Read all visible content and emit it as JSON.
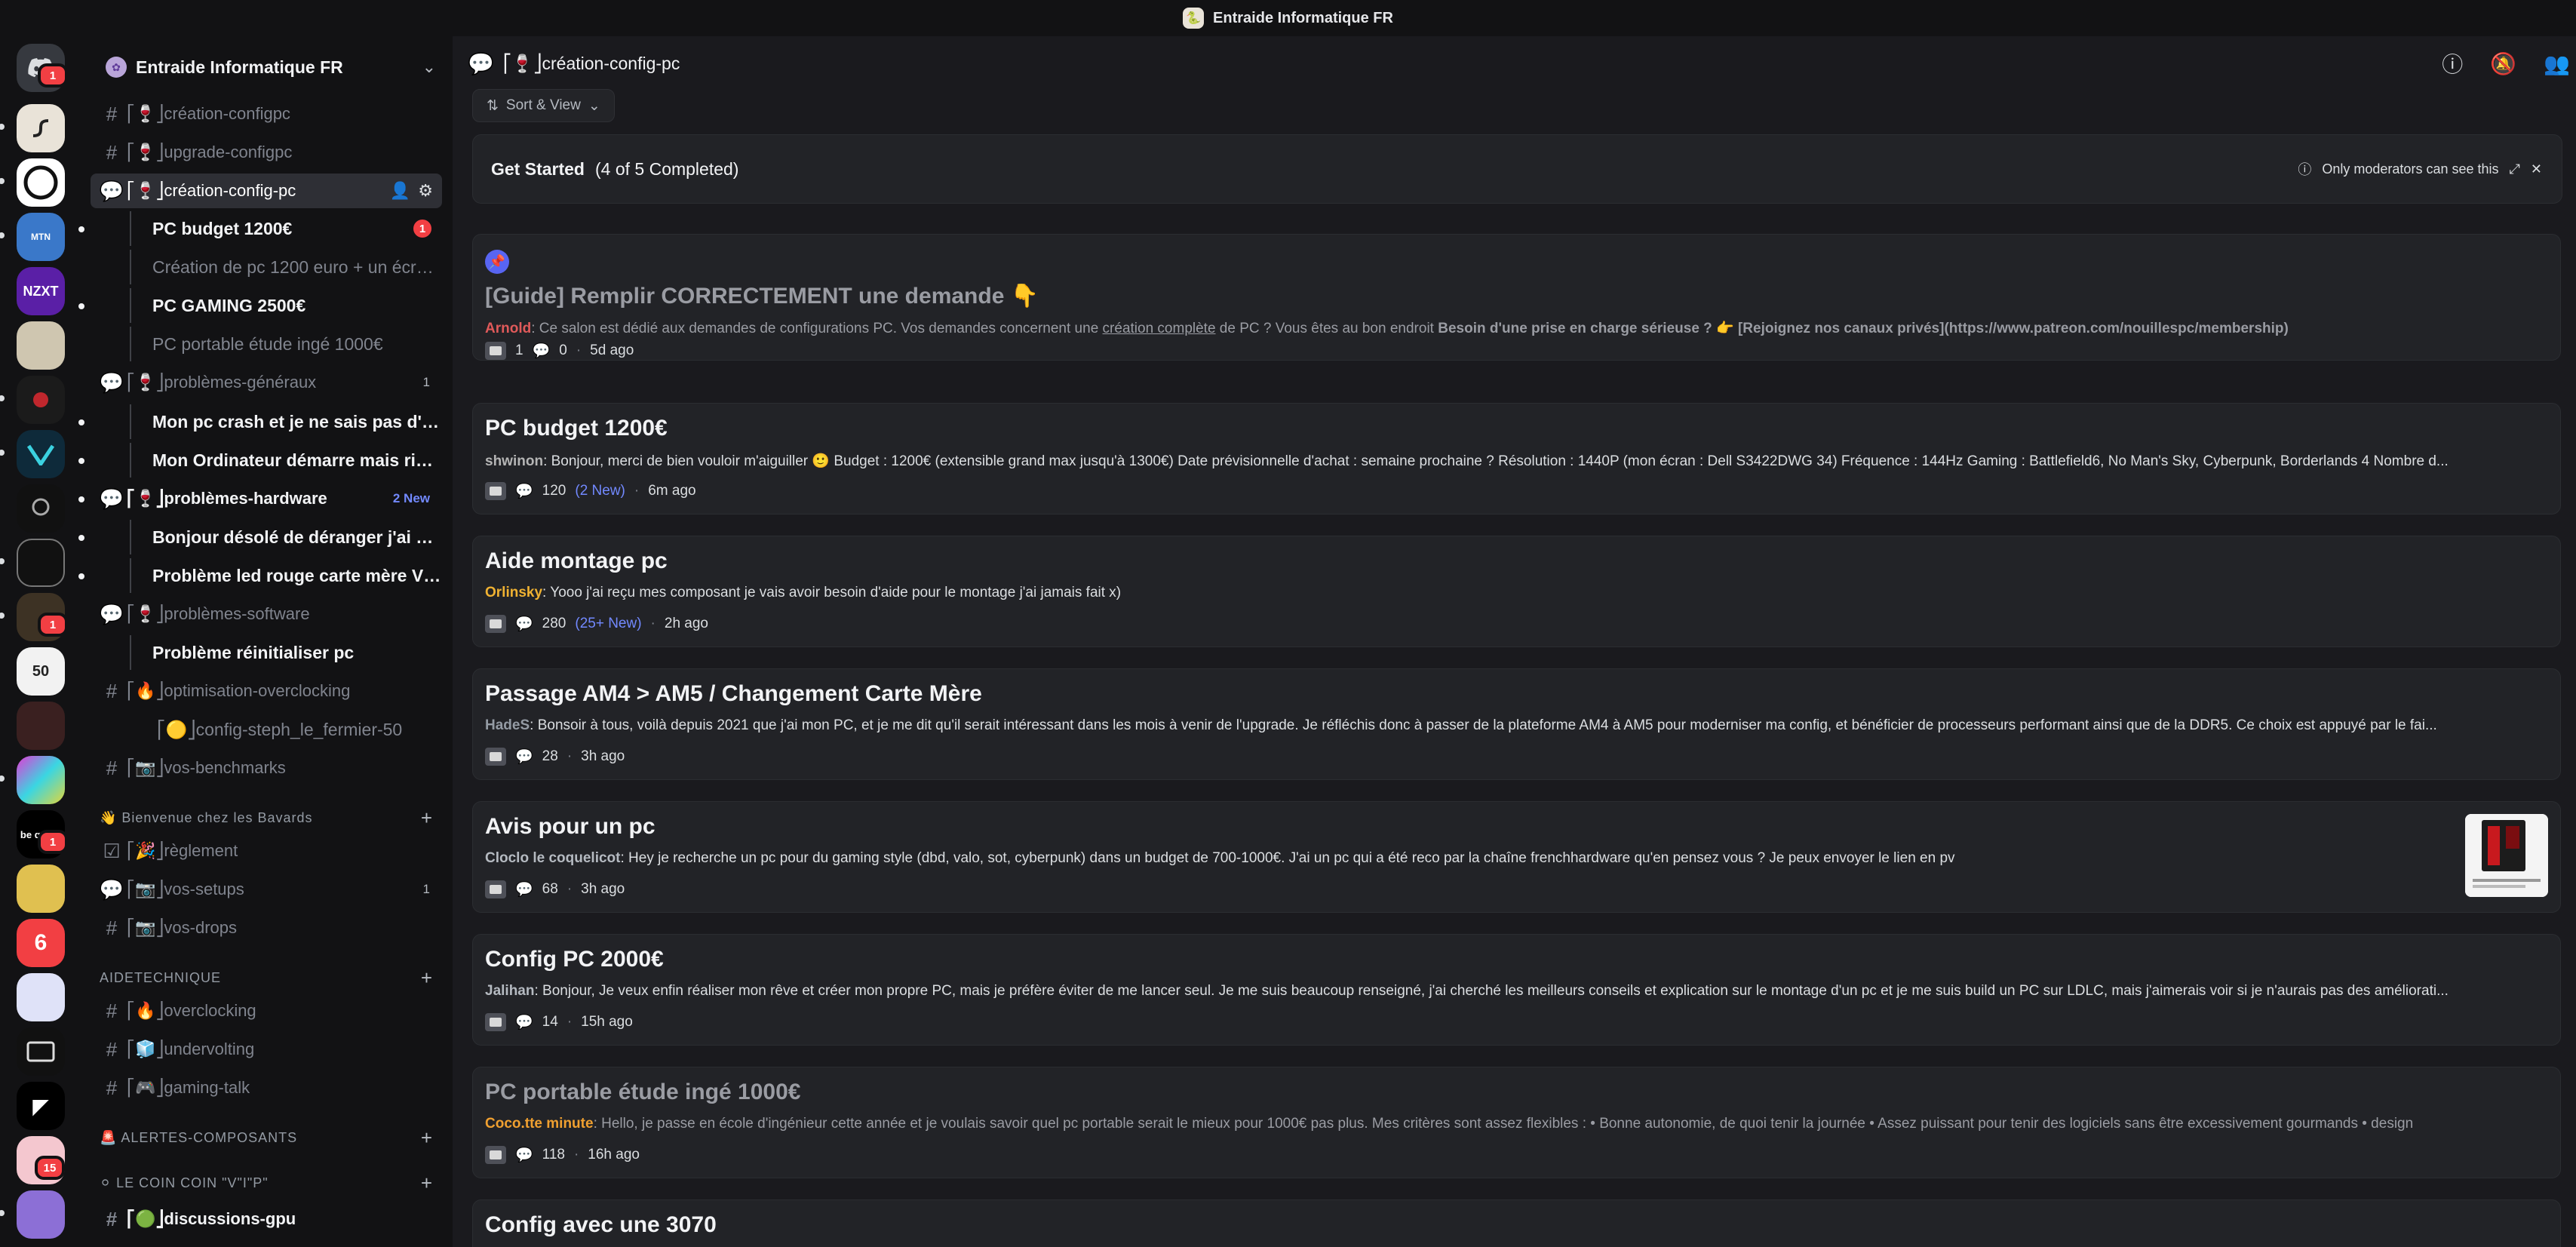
{
  "window": {
    "title": "Entraide Informatique FR"
  },
  "server_rail": {
    "badges": [
      "1",
      "1",
      "1",
      "1",
      "15"
    ]
  },
  "sidebar": {
    "server_name": "Entraide Informatique FR",
    "channels": {
      "creation_configpc": "⎡🍷⎦création-configpc",
      "upgrade_configpc": "⎡🍷⎦upgrade-configpc",
      "creation_config_pc": "⎡🍷⎦création-config-pc",
      "problemes_generaux": "⎡🍷⎦problèmes-généraux",
      "problemes_generaux_count": "1",
      "problemes_hardware": "⎡🍷⎦problèmes-hardware",
      "problemes_hardware_new": "2 New",
      "problemes_software": "⎡🍷⎦problèmes-software",
      "optimisation_overclocking": "⎡🔥⎦optimisation-overclocking",
      "config_steph": "⎡🟡⎦config-steph_le_fermier-50",
      "vos_benchmarks": "⎡📷⎦vos-benchmarks",
      "reglement": "⎡🎉⎦règlement",
      "vos_setups": "⎡📷⎦vos-setups",
      "vos_setups_count": "1",
      "vos_drops": "⎡📷⎦vos-drops",
      "overclocking": "⎡🔥⎦overclocking",
      "undervolting": "⎡🧊⎦undervolting",
      "gaming_talk": "⎡🎮⎦gaming-talk",
      "discussions_gpu": "⎡🟢⎦discussions-gpu"
    },
    "threads": {
      "pc_budget": "PC budget 1200€",
      "pc_budget_badge": "1",
      "creation_pc": "Création de pc 1200 euro + un écran ...",
      "pc_gaming": "PC GAMING 2500€",
      "pc_portable": "PC portable étude ingé 1000€",
      "mon_pc_crash": "Mon pc crash et je ne sais pas d'où ça...",
      "mon_ordinateur": "Mon Ordinateur démarre mais rien d...",
      "bonjour_desole": "Bonjour désolé de déranger j'ai achet...",
      "probleme_led": "Problème led rouge carte mère VGA ...",
      "probleme_reinit": "Problème réinitialiser pc"
    },
    "categories": {
      "bienvenue": "👋 Bienvenue chez les Bavards",
      "aidetechnique": "AIDETECHNIQUE",
      "alertes": "🚨 ALERTES-COMPOSANTS",
      "coin": "⚪ LE COIN COIN \"V\"I\"P\""
    }
  },
  "main": {
    "channel_title": "⎡🍷⎦création-config-pc",
    "sort_label": "Sort & View",
    "get_started": {
      "title": "Get Started",
      "progress": "(4 of 5 Completed)",
      "mod_note": "Only moderators can see this"
    },
    "posts": [
      {
        "title": "[Guide] Remplir CORRECTEMENT une demande 👇",
        "author": "Arnold",
        "snippet_a": ": Ce salon est dédié aux demandes de configurations PC. Vos demandes concernent une ",
        "snippet_link": "création complète",
        "snippet_b": " de PC ? Vous êtes au bon endroit ",
        "snippet_bold": "Besoin d'une prise en charge sérieuse ? 👉 [Rejoignez nos canaux privés](https://www.patreon.com/nouillespc/membership)",
        "tag_count": "1",
        "replies": "0",
        "time": "5d ago"
      },
      {
        "title": "PC budget 1200€",
        "author": "shwinon",
        "snippet": ": Bonjour, merci de bien vouloir m'aiguiller 🙂 Budget : 1200€ (extensible grand max jusqu'à 1300€) Date prévisionnelle d'achat : semaine prochaine ? Résolution : 1440P (mon écran : Dell S3422DWG 34) Fréquence : 144Hz Gaming : Battlefield6, No Man's Sky, Cyberpunk, Borderlands 4 Nombre d...",
        "replies": "120",
        "new": "(2 New)",
        "time": "6m ago"
      },
      {
        "title": "Aide montage pc",
        "author": "Orlinsky",
        "snippet": ": Yooo j'ai reçu mes composant je vais avoir besoin d'aide pour le montage j'ai jamais fait x)",
        "replies": "280",
        "new": "(25+ New)",
        "time": "2h ago"
      },
      {
        "title": "Passage AM4 > AM5 / Changement Carte Mère",
        "author": "HadeS",
        "snippet": ": Bonsoir à tous, voilà depuis 2021 que j'ai mon PC, et je me dit qu'il serait intéressant dans les mois à venir de l'upgrade. Je réfléchis donc à passer de la plateforme AM4 à AM5 pour moderniser ma config, et bénéficier de processeurs performant ainsi que de la DDR5. Ce choix est appuyé par le fai...",
        "replies": "28",
        "time": "3h ago"
      },
      {
        "title": "Avis pour un pc",
        "author": "Cloclo le coquelicot",
        "snippet": ": Hey je recherche un pc pour du gaming style (dbd, valo, sot, cyberpunk) dans un budget de 700-1000€. J'ai un pc qui a été reco par la chaîne frenchhardware qu'en pensez vous ? Je peux envoyer le lien en pv",
        "replies": "68",
        "time": "3h ago"
      },
      {
        "title": "Config PC 2000€",
        "author": "Jalihan",
        "snippet": ": Bonjour, Je veux enfin réaliser mon rêve et créer mon propre PC, mais je préfère éviter de me lancer seul. Je me suis beaucoup renseigné, j'ai cherché les meilleurs conseils et explication sur le montage d'un pc et je me suis build un PC sur LDLC, mais j'aimerais voir si je n'aurais pas des améliorati...",
        "replies": "14",
        "time": "15h ago"
      },
      {
        "title": "PC portable étude ingé 1000€",
        "author": "Coco.tte minute",
        "snippet": ": Hello, je passe en école d'ingénieur cette année et je voulais savoir quel pc portable serait le mieux pour 1000€ pas plus. Mes critères sont assez flexibles : • Bonne autonomie, de quoi tenir la journée  • Assez puissant pour tenir des logiciels sans être excessivement gourmands  • design",
        "replies": "118",
        "time": "16h ago"
      },
      {
        "title": "Config avec une 3070"
      }
    ]
  },
  "colors": {
    "accent_new": "#7289ff",
    "badge_red": "#f23f43",
    "author_arnold": "#e05a5a",
    "author_shwinon": "#b5b5b5",
    "author_orlinsky": "#f0b232",
    "author_hades": "#949ba4",
    "author_cloclo": "#b5bac1",
    "author_jalihan": "#b5bac1",
    "author_coco": "#f0a030"
  }
}
